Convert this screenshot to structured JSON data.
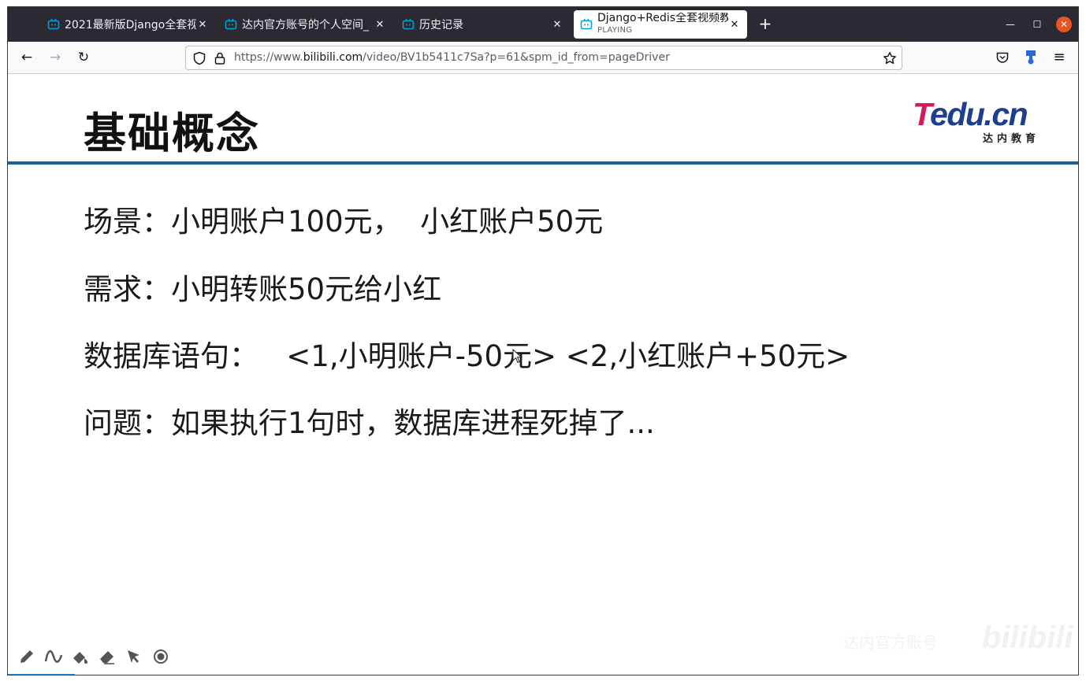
{
  "browser": {
    "tabs": [
      {
        "title": "2021最新版Django全套视",
        "subtitle": "",
        "active": false
      },
      {
        "title": "达内官方账号的个人空间_",
        "subtitle": "",
        "active": false
      },
      {
        "title": "历史记录",
        "subtitle": "",
        "active": false
      },
      {
        "title": "Django+Redis全套视频教",
        "subtitle": "PLAYING",
        "active": true
      }
    ],
    "new_tab_label": "+",
    "url": {
      "prefix": "https://www.",
      "domain": "bilibili.com",
      "path": "/video/BV1b5411c7Sa?p=61&spm_id_from=pageDriver"
    }
  },
  "slide": {
    "title": "基础概念",
    "logo_brand_t": "T",
    "logo_brand_rest": "edu.cn",
    "logo_subtitle": "达内教育",
    "lines": [
      "场景：小明账户100元，  小红账户50元",
      "需求：小明转账50元给小红",
      "数据库语句：   <1,小明账户-50元> <2,小红账户+50元>",
      "问题：如果执行1句时，数据库进程死掉了..."
    ]
  },
  "watermark": {
    "text": "达内官方账号",
    "logo": "bilibili"
  },
  "colors": {
    "tabbar": "#2b2a33",
    "rule": "#1a5f9e",
    "logo_pink": "#d6195d",
    "logo_blue": "#1e3e8e",
    "close_button": "#e95420"
  },
  "icons": [
    "bilibili-tab-icon",
    "close-icon",
    "back-icon",
    "forward-icon",
    "reload-icon",
    "shield-icon",
    "lock-icon",
    "star-icon",
    "pocket-icon",
    "extension-icon",
    "menu-icon",
    "pen-icon",
    "curve-icon",
    "highlighter-icon",
    "eraser-icon",
    "pointer-icon",
    "record-icon"
  ]
}
